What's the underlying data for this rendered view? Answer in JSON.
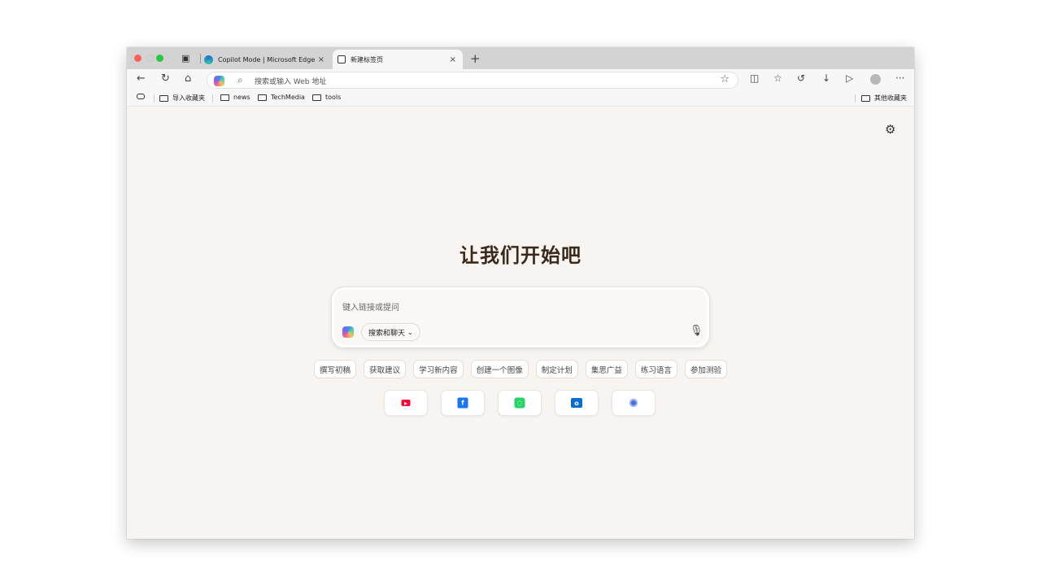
{
  "tabs": [
    {
      "label": "Copilot Mode | Microsoft Edge",
      "close": "×",
      "favicon_color": "#1b8a6b"
    },
    {
      "label": "新建标签页",
      "close": "×"
    }
  ],
  "newtab_glyph": "+",
  "addressbar": {
    "placeholder": "搜索或输入 Web 地址"
  },
  "bookmarks": {
    "import_label": "导入收藏夹",
    "items": [
      "news",
      "TechMedia",
      "tools"
    ],
    "other_label": "其他收藏夹"
  },
  "page": {
    "headline": "让我们开始吧",
    "chat_placeholder": "键入链接或提问",
    "mode_label": "搜索和聊天",
    "chips": [
      "撰写初稿",
      "获取建议",
      "学习新内容",
      "创建一个图像",
      "制定计划",
      "集思广益",
      "练习语言",
      "参加测验"
    ]
  },
  "tiles": [
    {
      "icon": "youtube-icon",
      "color": "#ff0033"
    },
    {
      "icon": "facebook-icon",
      "color": "#1877f2"
    },
    {
      "icon": "whatsapp-icon",
      "color": "#25d366"
    },
    {
      "icon": "outlook-icon",
      "color": "#0a6ed1"
    },
    {
      "icon": "chromium-icon",
      "color": "#4a6fd8"
    }
  ],
  "colors": {
    "accent_text": "#3b2a1c",
    "page_bg": "#f7f4f1"
  }
}
